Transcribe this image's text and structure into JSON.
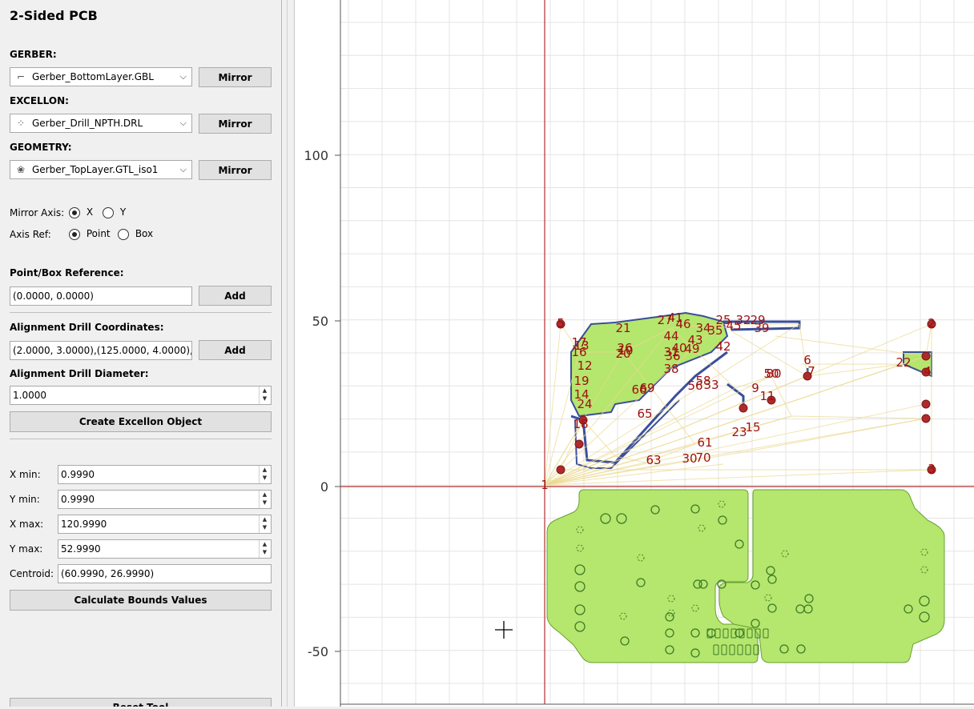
{
  "panel": {
    "title": "2-Sided PCB",
    "gerber_label": "GERBER:",
    "gerber_value": "Gerber_BottomLayer.GBL",
    "excellon_label": "EXCELLON:",
    "excellon_value": "Gerber_Drill_NPTH.DRL",
    "geometry_label": "GEOMETRY:",
    "geometry_value": "Gerber_TopLayer.GTL_iso1",
    "mirror_label": "Mirror",
    "mirror_axis_label": "Mirror Axis:",
    "axis_x": "X",
    "axis_y": "Y",
    "axis_ref_label": "Axis Ref:",
    "ref_point": "Point",
    "ref_box": "Box",
    "point_box_ref_label": "Point/Box Reference:",
    "point_box_ref_value": "(0.0000, 0.0000)",
    "add_label": "Add",
    "align_drill_coords_label": "Alignment Drill Coordinates:",
    "align_drill_coords_value": "(2.0000, 3.0000),(125.0000, 4.0000),",
    "align_drill_diam_label": "Alignment Drill Diameter:",
    "align_drill_diam_value": "1.0000",
    "create_excellon_label": "Create Excellon Object",
    "xmin_label": "X min:",
    "xmin_value": "0.9990",
    "ymin_label": "Y min:",
    "ymin_value": "0.9990",
    "xmax_label": "X max:",
    "xmax_value": "120.9990",
    "ymax_label": "Y max:",
    "ymax_value": "52.9990",
    "centroid_label": "Centroid:",
    "centroid_value": "(60.9990, 26.9990)",
    "calc_bounds_label": "Calculate Bounds Values",
    "reset_label": "Reset Tool"
  },
  "canvas": {
    "y_ticks": [
      "100",
      "50",
      "0",
      "-50"
    ],
    "axis_color": "#b03030",
    "copper_fill": "#b5e66e",
    "trace_color": "#3a4f9a",
    "travel_color": "#e9d88a",
    "drill_label_color": "#a01010",
    "drill_labels": [
      {
        "t": "5"
      },
      {
        "t": "2"
      },
      {
        "t": "4"
      },
      {
        "t": "3"
      },
      {
        "t": "1"
      },
      {
        "t": "17"
      },
      {
        "t": "16"
      },
      {
        "t": "13"
      },
      {
        "t": "12"
      },
      {
        "t": "19"
      },
      {
        "t": "18"
      },
      {
        "t": "14"
      },
      {
        "t": "24"
      },
      {
        "t": "21"
      },
      {
        "t": "20"
      },
      {
        "t": "10"
      },
      {
        "t": "26"
      },
      {
        "t": "27"
      },
      {
        "t": "44"
      },
      {
        "t": "41"
      },
      {
        "t": "40"
      },
      {
        "t": "31"
      },
      {
        "t": "36"
      },
      {
        "t": "38"
      },
      {
        "t": "56"
      },
      {
        "t": "58"
      },
      {
        "t": "66"
      },
      {
        "t": "69"
      },
      {
        "t": "65"
      },
      {
        "t": "63"
      },
      {
        "t": "61"
      },
      {
        "t": "70"
      },
      {
        "t": "30"
      },
      {
        "t": "33"
      },
      {
        "t": "25"
      },
      {
        "t": "34"
      },
      {
        "t": "22"
      },
      {
        "t": "50"
      },
      {
        "t": "80"
      },
      {
        "t": "6"
      },
      {
        "t": "7"
      },
      {
        "t": "9"
      },
      {
        "t": "11"
      },
      {
        "t": "15"
      },
      {
        "t": "23"
      },
      {
        "t": "35"
      },
      {
        "t": "39"
      },
      {
        "t": "49"
      },
      {
        "t": "46"
      },
      {
        "t": "43"
      },
      {
        "t": "45"
      },
      {
        "t": "32"
      },
      {
        "t": "29"
      },
      {
        "t": "42"
      }
    ]
  }
}
